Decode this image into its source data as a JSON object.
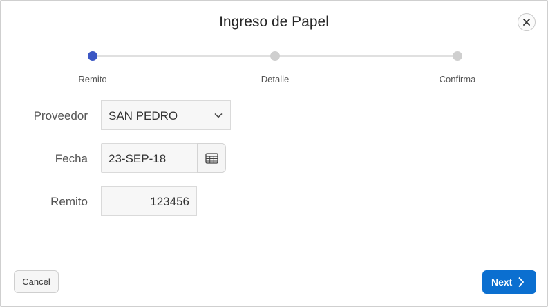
{
  "dialog": {
    "title": "Ingreso de Papel",
    "close_icon": "close-icon"
  },
  "wizard": {
    "steps": [
      {
        "label": "Remito",
        "state": "active"
      },
      {
        "label": "Detalle",
        "state": "pending"
      },
      {
        "label": "Confirma",
        "state": "pending"
      }
    ],
    "active_color": "#3b57c4",
    "pending_color": "#cfcfcf"
  },
  "form": {
    "proveedor": {
      "label": "Proveedor",
      "value": "SAN PEDRO",
      "icon": "chevron-down-icon"
    },
    "fecha": {
      "label": "Fecha",
      "value": "23-SEP-18",
      "icon": "calendar-icon"
    },
    "remito": {
      "label": "Remito",
      "value": "123456"
    }
  },
  "footer": {
    "cancel_label": "Cancel",
    "next_label": "Next",
    "next_icon": "chevron-right-icon",
    "primary_color": "#0b6fd0"
  }
}
